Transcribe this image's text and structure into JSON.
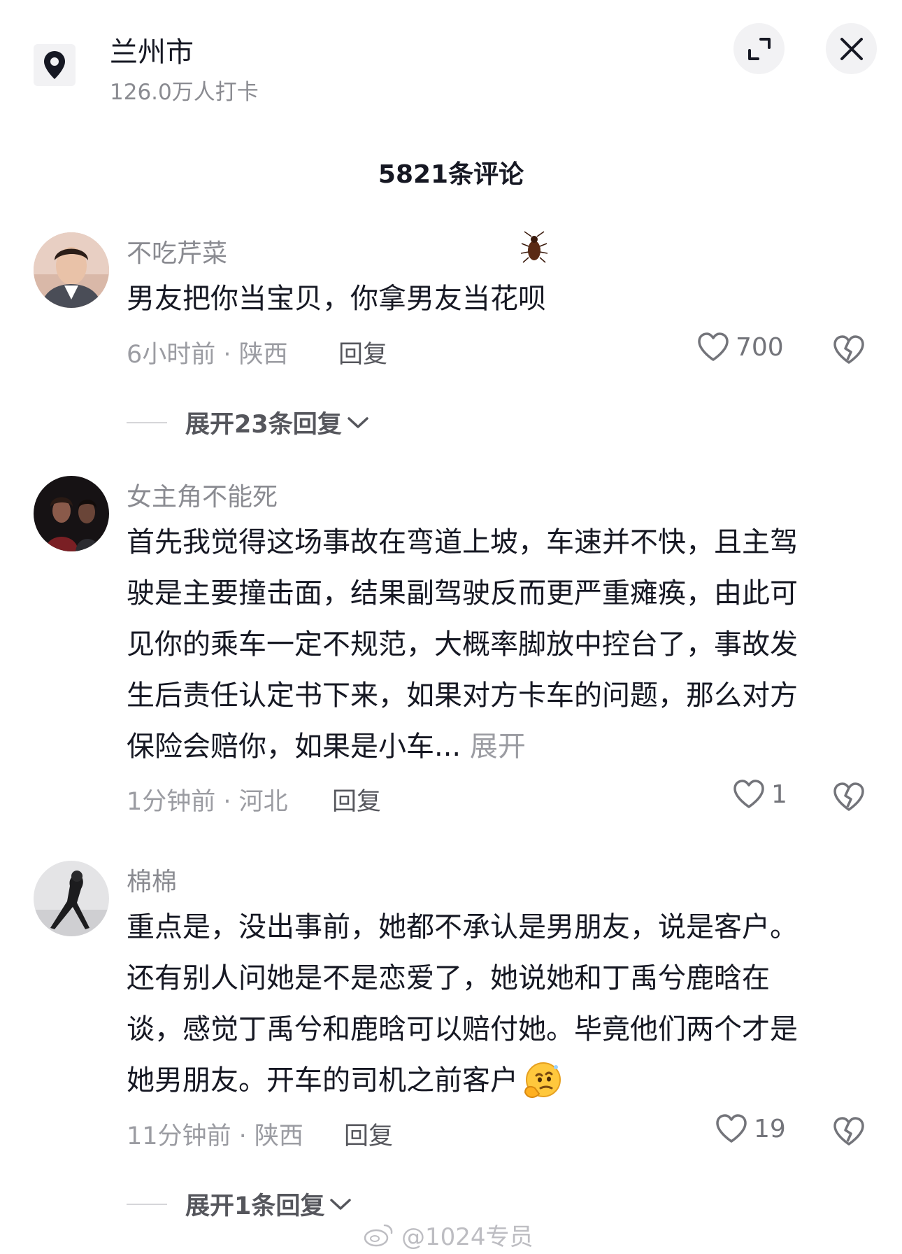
{
  "location": {
    "name": "兰州市",
    "checkins": "126.0万人打卡"
  },
  "header": {
    "comment_count": "5821条评论"
  },
  "comments": [
    {
      "username": "不吃芹菜",
      "lines": [
        "男友把你当宝贝，你拿男友当花呗"
      ],
      "time_region": "6小时前 · 陕西",
      "reply_label": "回复",
      "likes": "700",
      "expand_label": "展开23条回复"
    },
    {
      "username": "女主角不能死",
      "lines": [
        "首先我觉得这场事故在弯道上坡，车速并不快，且主驾",
        "驶是主要撞击面，结果副驾驶反而更严重瘫痪，由此可",
        "见你的乘车一定不规范，大概率脚放中控台了，事故发",
        "生后责任认定书下来，如果对方卡车的问题，那么对方",
        "保险会赔你，如果是小车..."
      ],
      "more_label": "展开",
      "time_region": "1分钟前 · 河北",
      "reply_label": "回复",
      "likes": "1"
    },
    {
      "username": "棉棉",
      "lines": [
        "重点是，没出事前，她都不承认是男朋友，说是客户。",
        "还有别人问她是不是恋爱了，她说她和丁禹兮鹿晗在",
        "谈，感觉丁禹兮和鹿晗可以赔付她。毕竟他们两个才是",
        "她男朋友。开车的司机之前客户"
      ],
      "time_region": "11分钟前 · 陕西",
      "reply_label": "回复",
      "likes": "19",
      "expand_label": "展开1条回复"
    }
  ],
  "watermark": "@1024专员",
  "colors": {
    "text": "#161823",
    "secondary": "#8a8b91",
    "button_bg": "#f2f2f4"
  }
}
